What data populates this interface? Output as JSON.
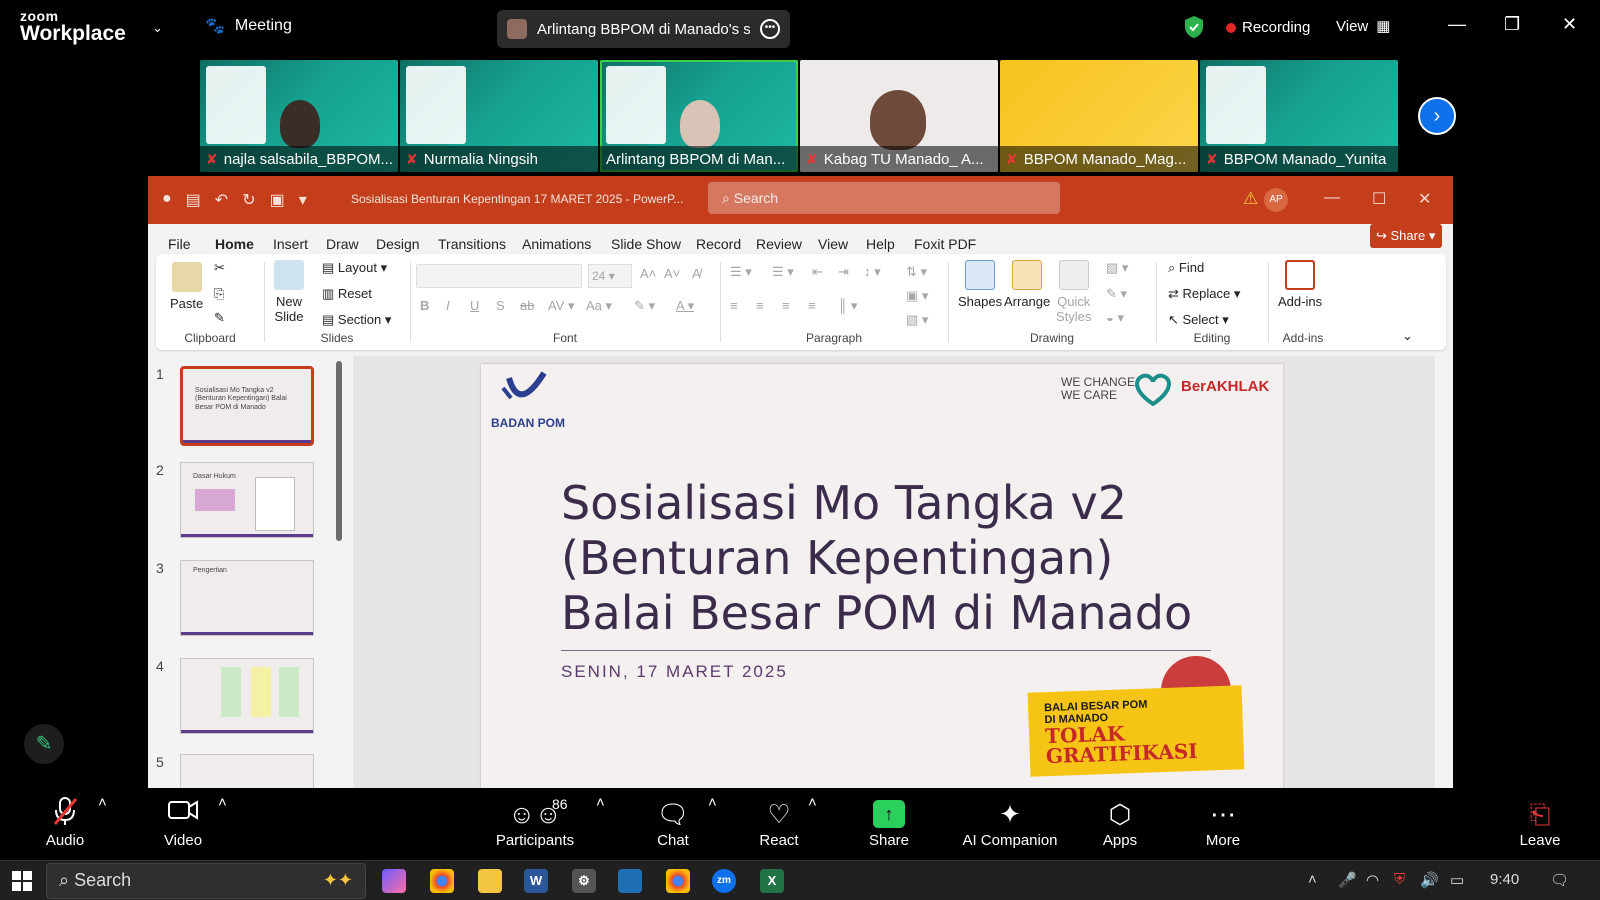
{
  "zoom": {
    "logo_line1": "zoom",
    "logo_line2": "Workplace",
    "meeting_label": "Meeting",
    "share_pill_text": "Arlintang BBPOM di Manado's sc",
    "recording_label": "Recording",
    "view_label": "View",
    "participants": [
      {
        "name": "najla salsabila_BBPOM..."
      },
      {
        "name": "Nurmalia Ningsih"
      },
      {
        "name": "Arlintang BBPOM di Man..."
      },
      {
        "name": "Kabag TU Manado_ A..."
      },
      {
        "name": "BBPOM Manado_Mag..."
      },
      {
        "name": "BBPOM Manado_Yunita"
      }
    ]
  },
  "ppt": {
    "doc_title": "Sosialisasi Benturan Kepentingan 17 MARET 2025  -  PowerP...",
    "search_placeholder": "Search",
    "user_initials": "AP",
    "share_label": "Share",
    "tabs": [
      "File",
      "Home",
      "Insert",
      "Draw",
      "Design",
      "Transitions",
      "Animations",
      "Slide Show",
      "Record",
      "Review",
      "View",
      "Help",
      "Foxit PDF"
    ],
    "ribbon": {
      "paste": "Paste",
      "new_slide_1": "New",
      "new_slide_2": "Slide",
      "layout": "Layout",
      "reset": "Reset",
      "section": "Section",
      "font_size": "24",
      "shapes": "Shapes",
      "arrange": "Arrange",
      "quick_styles_1": "Quick",
      "quick_styles_2": "Styles",
      "find": "Find",
      "replace": "Replace",
      "select": "Select",
      "addins": "Add-ins",
      "groups": {
        "clipboard": "Clipboard",
        "slides": "Slides",
        "font": "Font",
        "paragraph": "Paragraph",
        "drawing": "Drawing",
        "editing": "Editing",
        "addins": "Add-ins"
      }
    },
    "thumbnails": [
      {
        "num": "1",
        "text": "Sosialisasi Mo Tangka v2 (Benturan Kepentingan) Balai Besar POM di Manado"
      },
      {
        "num": "2",
        "text": "Dasar Hukum"
      },
      {
        "num": "3",
        "text": "Pengertian"
      },
      {
        "num": "4",
        "text": ""
      },
      {
        "num": "5",
        "text": ""
      }
    ],
    "slide": {
      "org": "BADAN POM",
      "we_change_1": "WE CHANGE",
      "we_change_2": "WE CARE",
      "berakhlak": "BerAKHLAK",
      "title_lines": [
        "Sosialisasi Mo Tangka v2",
        "(Benturan Kepentingan)",
        "Balai Besar POM di Manado"
      ],
      "date": "SENIN, 17 MARET 2025",
      "badge_line1": "BALAI BESAR POM",
      "badge_line2": "DI MANADO",
      "badge_line3": "TOLAK",
      "badge_line4": "GRATIFIKASI"
    }
  },
  "toolbar": {
    "audio": "Audio",
    "video": "Video",
    "participants": "Participants",
    "participant_count": "86",
    "chat": "Chat",
    "react": "React",
    "share": "Share",
    "ai": "AI Companion",
    "apps": "Apps",
    "more": "More",
    "leave": "Leave"
  },
  "taskbar": {
    "search": "Search",
    "time": "9:40"
  },
  "colors": {
    "ppt_accent": "#c43e1c",
    "zoom_blue": "#0e71eb",
    "share_green": "#2bd05c"
  }
}
